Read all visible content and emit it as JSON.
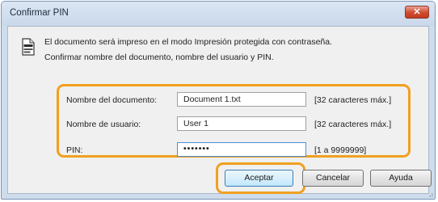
{
  "window": {
    "title": "Confirmar PIN",
    "close_icon": "close-icon",
    "close_glyph": "✕"
  },
  "info": {
    "icon": "document-icon",
    "line1": "El documento será impreso en el modo Impresión protegida con contraseña.",
    "line2": "Confirmar nombre del documento, nombre del usuario y PIN."
  },
  "form": {
    "document_name": {
      "label": "Nombre del documento:",
      "value": "Document 1.txt",
      "hint": "[32 caracteres máx.]"
    },
    "user_name": {
      "label": "Nombre de usuario:",
      "value": "User 1",
      "hint": "[32 caracteres máx.]"
    },
    "pin": {
      "label": "PIN:",
      "value": "•••••••",
      "hint": "[1 a 9999999]"
    }
  },
  "buttons": {
    "ok": "Aceptar",
    "cancel": "Cancelar",
    "help": "Ayuda"
  },
  "colors": {
    "highlight": "#f0a020",
    "close_button": "#cf4a2e",
    "focused_border": "#4a90d9"
  }
}
